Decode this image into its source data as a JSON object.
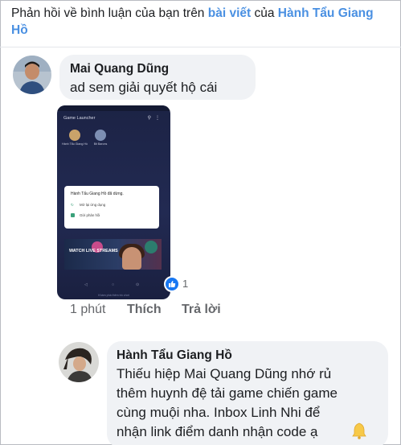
{
  "notification": {
    "prefix": "Phản hồi về bình luận của bạn trên ",
    "link1": "bài viết",
    "middle": " của ",
    "link2": "Hành Tẩu Giang Hồ"
  },
  "comment1": {
    "author": "Mai Quang Dũng",
    "text": "ad sem giải quyết hộ cái",
    "time": "1 phút",
    "like_label": "Thích",
    "reply_label": "Trả lời",
    "reaction_count": "1"
  },
  "attachment": {
    "title": "Game Launcher",
    "apps": [
      {
        "label": "Hành Tẩu Giang Hồ",
        "color": "#c9a36a"
      },
      {
        "label": "Bit Barons",
        "color": "#7d8fb3"
      }
    ],
    "popup_title": "Hành Tẩu Giang Hồ đã dừng.",
    "popup_options": [
      "Mở lại ứng dụng",
      "Gửi phản hồi"
    ],
    "banner_text": "WATCH LIVE STREAMS",
    "bottom_text": "Khám phá thêm trò chơi"
  },
  "comment2": {
    "author": "Hành Tẩu Giang Hồ",
    "lines": [
      "Thiếu hiệp Mai Quang Dũng nhớ rủ",
      "thêm huynh đệ tải game chiến game",
      "cùng muội nha. Inbox Linh Nhi để",
      "nhận link điểm danh nhận code ạ"
    ],
    "emoji": "bell-emoji"
  },
  "colors": {
    "link": "#4a90e2",
    "bubble": "#f0f2f5",
    "muted": "#65676b",
    "like_blue": "#1877f2"
  }
}
